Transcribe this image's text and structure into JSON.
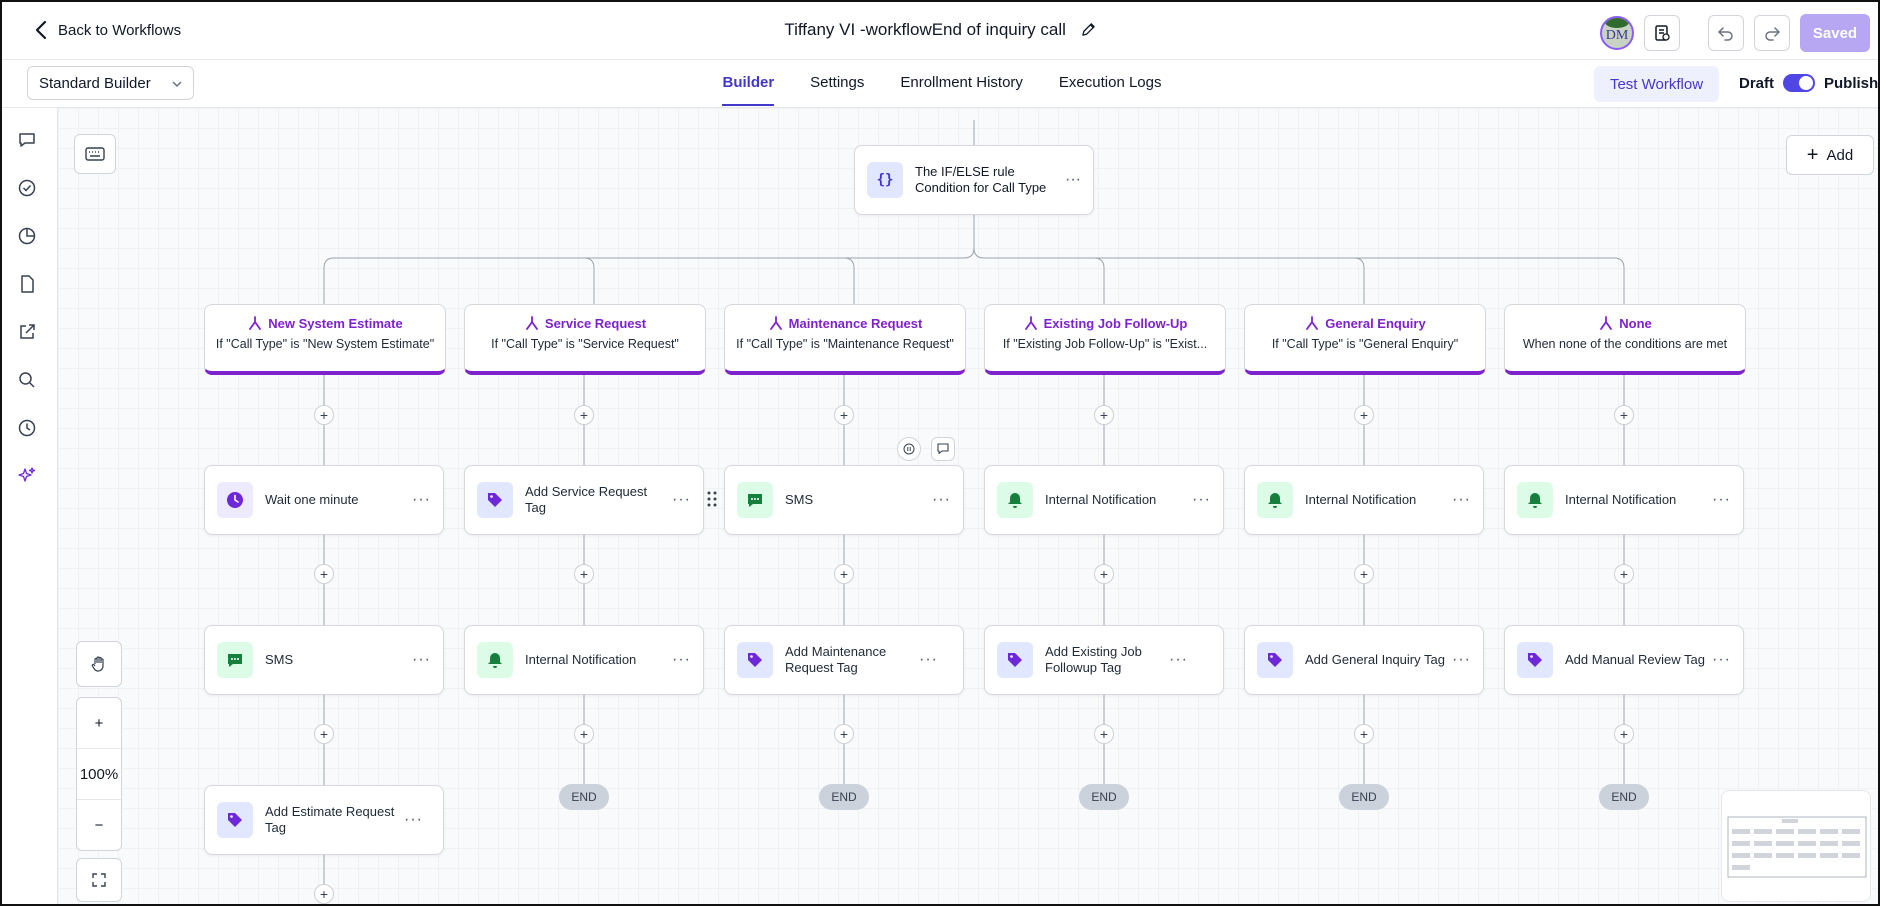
{
  "header": {
    "back_label": "Back to Workflows",
    "title": "Tiffany VI -workflowEnd of inquiry call",
    "avatar_initials": "DM",
    "saved_label": "Saved"
  },
  "toolbar": {
    "builder_select": "Standard Builder",
    "tabs": [
      {
        "label": "Builder",
        "active": true
      },
      {
        "label": "Settings",
        "active": false
      },
      {
        "label": "Enrollment History",
        "active": false
      },
      {
        "label": "Execution Logs",
        "active": false
      }
    ],
    "test_workflow": "Test Workflow",
    "draft_label": "Draft",
    "publish_label": "Publish"
  },
  "canvas": {
    "add_label": "Add",
    "zoom_level": "100%",
    "root": {
      "line1": "The IF/ELSE rule",
      "line2": "Condition for Call Type"
    },
    "branches": [
      {
        "title": "New System Estimate",
        "desc": "If \"Call Type\" is \"New System Estimate\""
      },
      {
        "title": "Service Request",
        "desc": "If \"Call Type\" is \"Service Request\""
      },
      {
        "title": "Maintenance Request",
        "desc": "If \"Call Type\" is \"Maintenance Request\""
      },
      {
        "title": "Existing Job Follow-Up",
        "desc": "If \"Existing Job Follow-Up\" is \"Exist..."
      },
      {
        "title": "General Enquiry",
        "desc": "If \"Call Type\" is \"General Enquiry\""
      },
      {
        "title": "None",
        "desc": "When none of the conditions are met"
      }
    ],
    "steps": [
      [
        {
          "label": "Wait one minute",
          "icon": "clock-icon"
        },
        {
          "label": "SMS",
          "icon": "sms-icon"
        },
        {
          "label": "Add Estimate Request Tag",
          "icon": "tag-icon"
        }
      ],
      [
        {
          "label": "Add Service Request Tag",
          "icon": "tag-icon"
        },
        {
          "label": "Internal Notification",
          "icon": "bell-icon"
        }
      ],
      [
        {
          "label": "SMS",
          "icon": "sms-icon"
        },
        {
          "label": "Add Maintenance Request Tag",
          "icon": "tag-icon"
        }
      ],
      [
        {
          "label": "Internal Notification",
          "icon": "bell-icon"
        },
        {
          "label": "Add Existing Job Followup Tag",
          "icon": "tag-icon"
        }
      ],
      [
        {
          "label": "Internal Notification",
          "icon": "bell-icon"
        },
        {
          "label": "Add General Inquiry Tag",
          "icon": "tag-icon"
        }
      ],
      [
        {
          "label": "Internal Notification",
          "icon": "bell-icon"
        },
        {
          "label": "Add Manual Review Tag",
          "icon": "tag-icon"
        }
      ]
    ],
    "end_label": "END"
  },
  "colors": {
    "accent": "#4338ca",
    "branch": "#7e22ce",
    "green_icon": "#16a34a",
    "purple_icon": "#6d28d9"
  }
}
